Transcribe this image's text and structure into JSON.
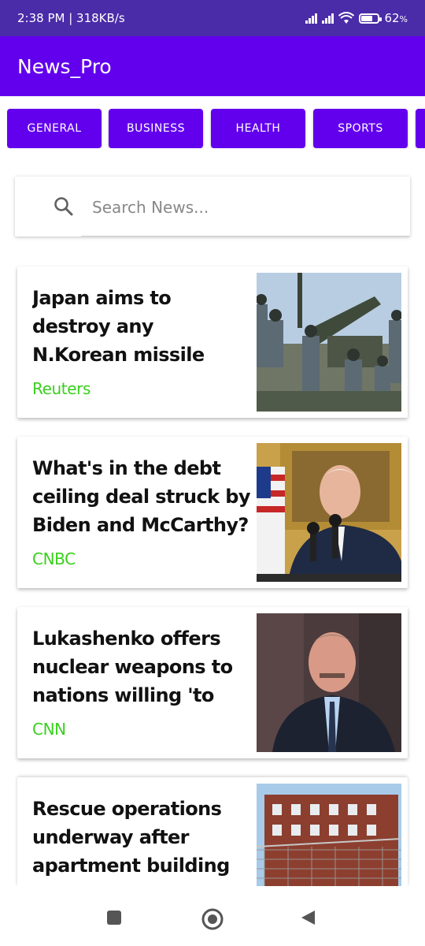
{
  "status_bar": {
    "time_speed": "2:38 PM | 318KB/s",
    "battery_percent": "62",
    "battery_suffix": "%"
  },
  "app_bar": {
    "title": "News_Pro"
  },
  "categories": [
    "GENERAL",
    "BUSINESS",
    "HEALTH",
    "SPORTS"
  ],
  "search": {
    "placeholder": "Search News..."
  },
  "articles": [
    {
      "title": "Japan aims to destroy any N.Korean missile after it warns",
      "source": "Reuters"
    },
    {
      "title": "What's in the debt ceiling deal struck by Biden and McCarthy?",
      "source": "CNBC"
    },
    {
      "title": "Lukashenko offers nuclear weapons to nations willing 'to join",
      "source": "CNN"
    },
    {
      "title": "Rescue operations underway after apartment building",
      "source": ""
    }
  ],
  "colors": {
    "status_bar": "#4a2ba8",
    "primary": "#6200ee",
    "source_text": "#39d01c"
  },
  "nav": {
    "icons": [
      "square-recents-icon",
      "circle-home-icon",
      "triangle-back-icon"
    ]
  }
}
